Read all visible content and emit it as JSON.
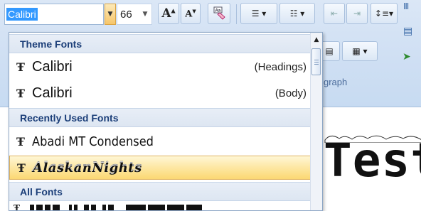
{
  "ribbon": {
    "font_name": "Calibri",
    "font_size": "66",
    "grow_font_glyph": "A",
    "shrink_font_glyph": "A",
    "group_label": "graph"
  },
  "dropdown": {
    "sections": [
      {
        "header": "Theme Fonts"
      },
      {
        "header": "Recently Used Fonts"
      },
      {
        "header": "All Fonts"
      }
    ],
    "theme_fonts": [
      {
        "name": "Calibri",
        "note": "(Headings)"
      },
      {
        "name": "Calibri",
        "note": "(Body)"
      }
    ],
    "recent_fonts": [
      {
        "name": "Abadi MT Condensed"
      },
      {
        "name": "AlaskanNights"
      }
    ],
    "selected_font": "AlaskanNights",
    "font_icon": "truetype-font-icon"
  },
  "document": {
    "visible_text": "Test"
  },
  "colors": {
    "ribbon_bg": "#cfdff3",
    "selected_highlight": "#fbd873",
    "header_text": "#1c3f79"
  }
}
